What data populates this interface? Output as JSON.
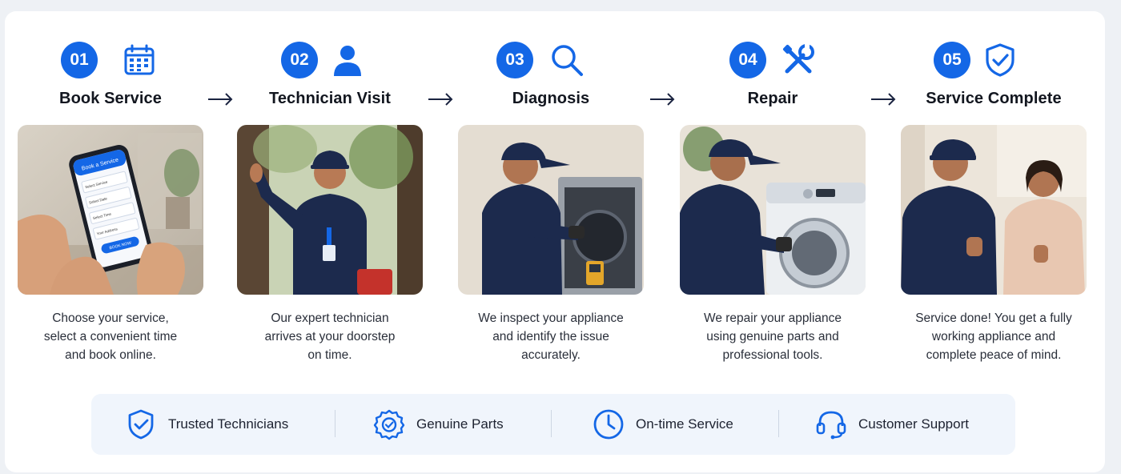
{
  "steps": [
    {
      "number": "01",
      "icon": "calendar-icon",
      "title": "Book Service",
      "desc": [
        "Choose your service,",
        "select a convenient time",
        "and book online."
      ],
      "phone": {
        "header": "Book a Service",
        "fields": [
          "Select Service",
          "Select Date",
          "Select Time",
          "Your Address"
        ],
        "button": "BOOK NOW"
      }
    },
    {
      "number": "02",
      "icon": "user-icon",
      "title": "Technician Visit",
      "desc": [
        "Our expert technician",
        "arrives at your doorstep",
        "on time."
      ]
    },
    {
      "number": "03",
      "icon": "search-icon",
      "title": "Diagnosis",
      "desc": [
        "We inspect your appliance",
        "and identify the issue",
        "accurately."
      ]
    },
    {
      "number": "04",
      "icon": "tools-icon",
      "title": "Repair",
      "desc": [
        "We repair your appliance",
        "using genuine parts and",
        "professional tools."
      ]
    },
    {
      "number": "05",
      "icon": "shield-check-icon",
      "title": "Service Complete",
      "desc": [
        "Service done! You get a fully",
        "working appliance and",
        "complete peace of mind."
      ]
    }
  ],
  "features": [
    {
      "icon": "shield-check-icon",
      "label": "Trusted Technicians"
    },
    {
      "icon": "badge-gear-icon",
      "label": "Genuine Parts"
    },
    {
      "icon": "clock-icon",
      "label": "On-time Service"
    },
    {
      "icon": "headset-icon",
      "label": "Customer Support"
    }
  ],
  "colors": {
    "accent": "#1467e6",
    "navy": "#1c2a4d",
    "background": "#ffffff",
    "feature_bar": "#f0f5fc"
  }
}
